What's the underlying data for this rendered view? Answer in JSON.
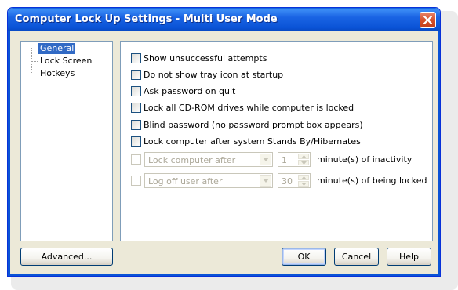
{
  "window": {
    "title": "Computer Lock Up Settings - Multi User Mode"
  },
  "tree": {
    "items": [
      {
        "label": "General",
        "selected": true
      },
      {
        "label": "Lock Screen",
        "selected": false
      },
      {
        "label": "Hotkeys",
        "selected": false
      }
    ]
  },
  "general": {
    "options": [
      {
        "label": "Show unsuccessful attempts",
        "checked": false
      },
      {
        "label": "Do not show tray icon at startup",
        "checked": false
      },
      {
        "label": "Ask password on quit",
        "checked": false
      },
      {
        "label": "Lock all CD-ROM drives while computer is locked",
        "checked": false
      },
      {
        "label": "Blind password (no password prompt box appears)",
        "checked": false
      },
      {
        "label": "Lock computer after system Stands By/Hibernates",
        "checked": false
      }
    ],
    "lock_after": {
      "checked": false,
      "select_value": "Lock computer after",
      "minutes": "1",
      "suffix": "minute(s) of inactivity"
    },
    "logoff_after": {
      "checked": false,
      "select_value": "Log off user after",
      "minutes": "30",
      "suffix": "minute(s) of being locked"
    }
  },
  "buttons": {
    "advanced": "Advanced...",
    "ok": "OK",
    "cancel": "Cancel",
    "help": "Help"
  },
  "icons": {
    "close": "close-icon",
    "dropdown": "chevron-down-icon",
    "spin_up": "chevron-up-icon",
    "spin_down": "chevron-down-icon"
  },
  "colors": {
    "titlebar": "#0a53d6",
    "selection": "#316ac5",
    "dialog_bg": "#ece9d8",
    "close_button": "#d6512c",
    "disabled_text": "#aca899"
  }
}
